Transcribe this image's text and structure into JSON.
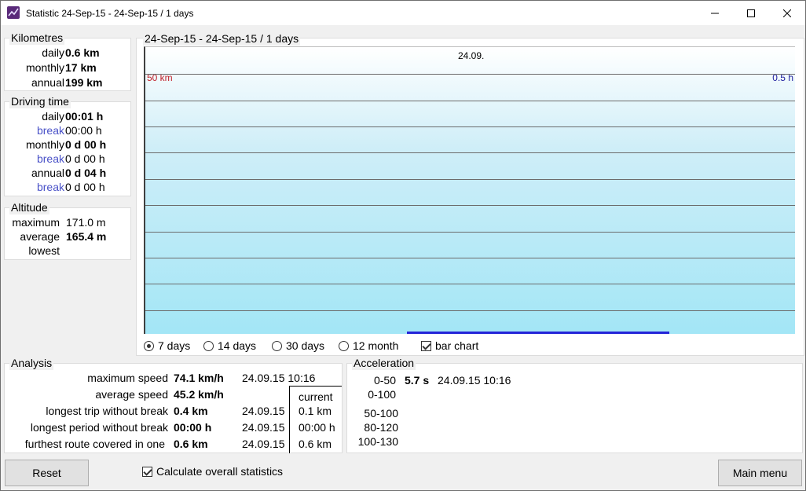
{
  "window": {
    "title": "Statistic 24-Sep-15 - 24-Sep-15 / 1 days"
  },
  "kilometres": {
    "title": "Kilometres",
    "rows": [
      {
        "label": "daily",
        "value": "0.6 km"
      },
      {
        "label": "monthly",
        "value": "17 km"
      },
      {
        "label": "annual",
        "value": "199 km"
      }
    ]
  },
  "driving_time": {
    "title": "Driving time",
    "rows": [
      {
        "label": "daily",
        "value": "00:01 h"
      },
      {
        "label": "break",
        "value": "00:00 h"
      },
      {
        "label": "monthly",
        "value": "0 d 00 h"
      },
      {
        "label": "break",
        "value": "0 d 00 h"
      },
      {
        "label": "annual",
        "value": "0 d 04 h"
      },
      {
        "label": "break",
        "value": "0 d 00 h"
      }
    ]
  },
  "altitude": {
    "title": "Altitude",
    "rows": [
      {
        "label": "maximum",
        "value": "171.0 m"
      },
      {
        "label": "average",
        "value": "165.4 m"
      },
      {
        "label": "lowest",
        "value": ""
      }
    ]
  },
  "chart": {
    "title": "24-Sep-15 - 24-Sep-15 / 1 days",
    "date_label": "24.09.",
    "left_axis_label": "50 km",
    "right_axis_label": "0.5 h",
    "left_color": "#c0202a",
    "right_color": "#2020a0",
    "bar_color": "#2424d8"
  },
  "chart_data": {
    "type": "bar",
    "categories": [
      "24.09."
    ],
    "series": [
      {
        "values": [
          0.6
        ]
      }
    ],
    "y_max_km": 50,
    "y_max_h": 0.5
  },
  "period_options": [
    {
      "label": "7 days",
      "selected": true
    },
    {
      "label": "14 days",
      "selected": false
    },
    {
      "label": "30 days",
      "selected": false
    },
    {
      "label": "12 month",
      "selected": false
    }
  ],
  "bar_chart": {
    "label": "bar chart",
    "checked": true
  },
  "analysis": {
    "title": "Analysis",
    "current_header": "current",
    "rows": [
      {
        "label": "maximum speed",
        "value": "74.1 km/h",
        "date": "24.09.15 10:16",
        "current": ""
      },
      {
        "label": "average speed",
        "value": "45.2 km/h",
        "date": "",
        "current": ""
      },
      {
        "label": "longest trip without break",
        "value": "0.4 km",
        "date": "24.09.15",
        "current": "0.1 km"
      },
      {
        "label": "longest period without break",
        "value": "00:00 h",
        "date": "24.09.15",
        "current": "00:00 h"
      },
      {
        "label": "furthest route covered in one",
        "value": "0.6 km",
        "date": "24.09.15",
        "current": "0.6 km"
      }
    ]
  },
  "acceleration": {
    "title": "Acceleration",
    "rows": [
      {
        "label": "0-50",
        "value": "5.7 s",
        "date": "24.09.15 10:16"
      },
      {
        "label": "0-100",
        "value": "",
        "date": ""
      },
      {
        "label": "50-100",
        "value": "",
        "date": ""
      },
      {
        "label": "80-120",
        "value": "",
        "date": ""
      },
      {
        "label": "100-130",
        "value": "",
        "date": ""
      }
    ]
  },
  "footer": {
    "reset_label": "Reset",
    "calc_label": "Calculate overall statistics",
    "calc_checked": true,
    "main_menu_label": "Main menu"
  }
}
